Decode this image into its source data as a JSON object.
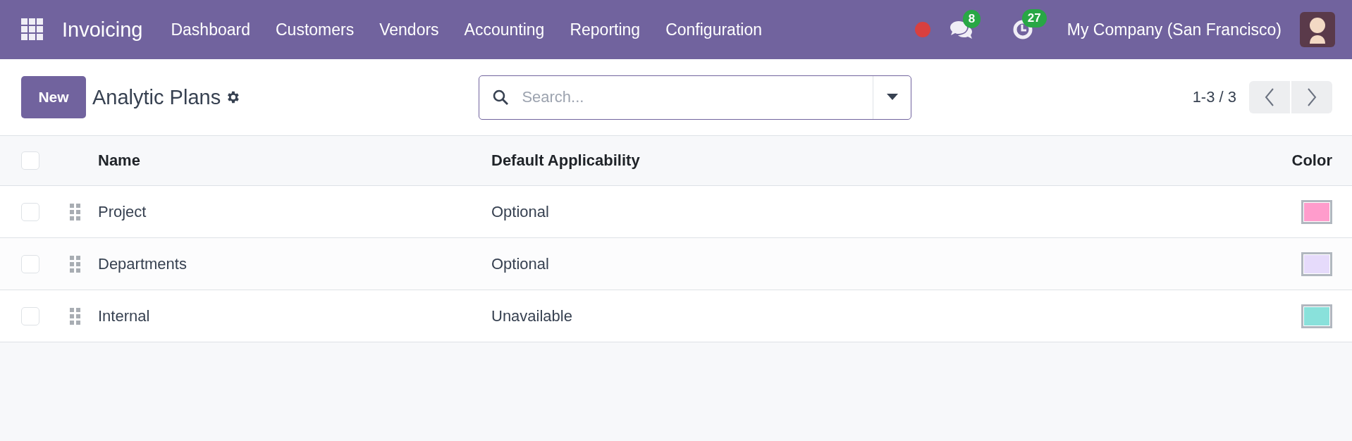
{
  "navbar": {
    "app_name": "Invoicing",
    "menu": [
      "Dashboard",
      "Customers",
      "Vendors",
      "Accounting",
      "Reporting",
      "Configuration"
    ],
    "messages_count": "8",
    "activities_count": "27",
    "company": "My Company (San Francisco)"
  },
  "control_panel": {
    "new_button": "New",
    "title": "Analytic Plans",
    "search": {
      "placeholder": "Search..."
    },
    "pager": "1-3 / 3"
  },
  "table": {
    "select_all_checked": false,
    "columns": [
      "Name",
      "Default Applicability",
      "Color"
    ],
    "rows": [
      {
        "name": "Project",
        "applicability": "Optional",
        "color": "#ff9ccc",
        "checked": false
      },
      {
        "name": "Departments",
        "applicability": "Optional",
        "color": "#e6dbfb",
        "checked": false
      },
      {
        "name": "Internal",
        "applicability": "Unavailable",
        "color": "#89e1db",
        "checked": false
      }
    ]
  }
}
